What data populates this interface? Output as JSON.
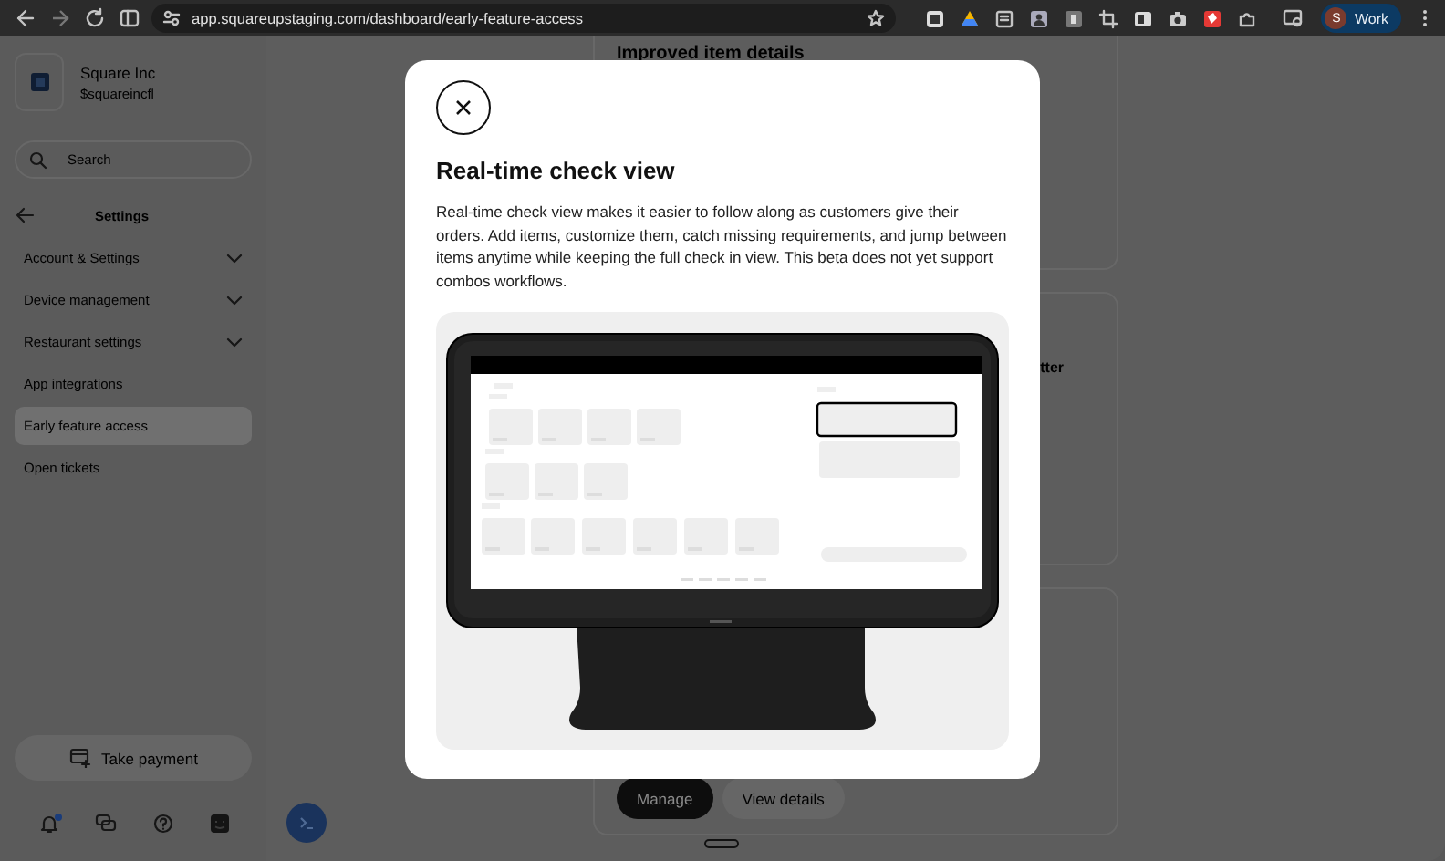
{
  "browser": {
    "url": "app.squareupstaging.com/dashboard/early-feature-access",
    "profile": {
      "initial": "S",
      "label": "Work"
    }
  },
  "sidebar": {
    "business": {
      "name": "Square Inc",
      "handle": "$squareincfl"
    },
    "search": {
      "placeholder": "Search"
    },
    "section_title": "Settings",
    "items": [
      {
        "label": "Account & Settings",
        "expandable": true,
        "selected": false
      },
      {
        "label": "Device management",
        "expandable": true,
        "selected": false
      },
      {
        "label": "Restaurant settings",
        "expandable": true,
        "selected": false
      },
      {
        "label": "App integrations",
        "expandable": false,
        "selected": false
      },
      {
        "label": "Early feature access",
        "expandable": false,
        "selected": true
      },
      {
        "label": "Open tickets",
        "expandable": false,
        "selected": false
      }
    ],
    "take_payment": "Take payment",
    "notification_badge": true
  },
  "main": {
    "heading": "Improved item details",
    "fragment": "tter",
    "buttons": [
      {
        "label": "Manage",
        "kind": "primary"
      },
      {
        "label": "View details",
        "kind": "secondary"
      }
    ]
  },
  "modal": {
    "title": "Real-time check view",
    "body": "Real-time check view makes it easier to follow along as customers give their orders. Add items, customize them, catch missing requirements, and jump between items anytime while keeping the full check in view. This beta does not yet support combos workflows."
  }
}
